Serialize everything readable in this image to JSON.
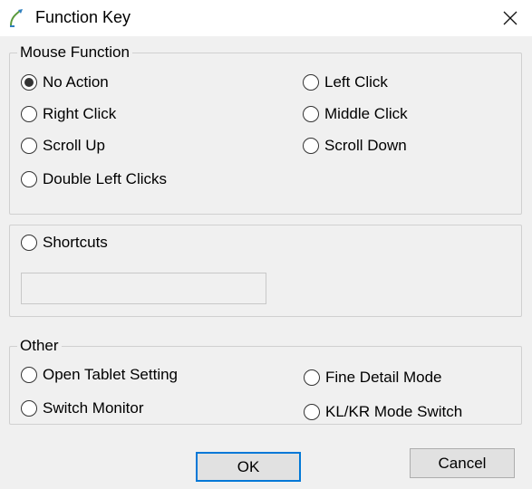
{
  "window": {
    "title": "Function Key"
  },
  "mouse_function": {
    "legend": "Mouse Function",
    "options": [
      {
        "label": "No Action",
        "selected": true
      },
      {
        "label": "Left Click",
        "selected": false
      },
      {
        "label": "Right Click",
        "selected": false
      },
      {
        "label": "Middle Click",
        "selected": false
      },
      {
        "label": "Scroll Up",
        "selected": false
      },
      {
        "label": "Scroll Down",
        "selected": false
      },
      {
        "label": "Double Left Clicks",
        "selected": false
      }
    ]
  },
  "shortcuts": {
    "label": "Shortcuts",
    "selected": false,
    "value": ""
  },
  "other": {
    "legend": "Other",
    "options": [
      {
        "label": "Open Tablet Setting",
        "selected": false
      },
      {
        "label": "Fine Detail Mode",
        "selected": false
      },
      {
        "label": "Switch Monitor",
        "selected": false
      },
      {
        "label": "KL/KR Mode Switch",
        "selected": false
      }
    ]
  },
  "buttons": {
    "ok": "OK",
    "cancel": "Cancel"
  },
  "colors": {
    "accent": "#0078d7",
    "background": "#f0f0f0"
  },
  "icons": {
    "app": "pen-tablet-icon",
    "close": "close-icon"
  }
}
